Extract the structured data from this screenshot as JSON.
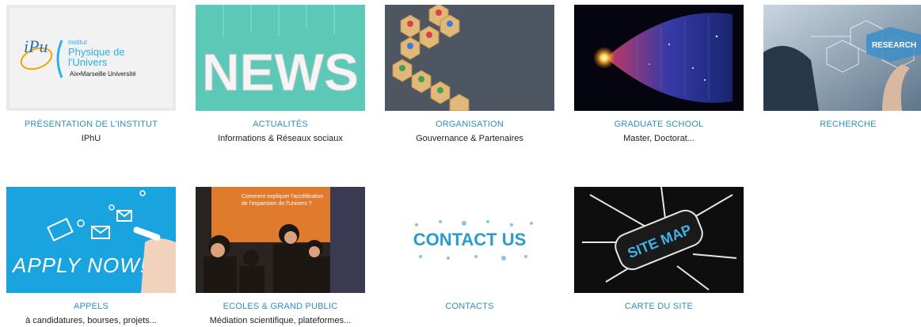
{
  "tiles": [
    {
      "title": "PRÉSENTATION DE L'INSTITUT",
      "subtitle": "IPhU",
      "logo": {
        "letters": "iPu",
        "line1": "Institut",
        "line2": "Physique de",
        "line3": "l'Univers",
        "line4": "Aix•Marseille Université"
      }
    },
    {
      "title": "ACTUALITÉS",
      "subtitle": "Informations & Réseaux sociaux",
      "image_text": "NEWS"
    },
    {
      "title": "ORGANISATION",
      "subtitle": "Gouvernance & Partenaires"
    },
    {
      "title": "GRADUATE SCHOOL",
      "subtitle": "Master, Doctorat..."
    },
    {
      "title": "RECHERCHE",
      "subtitle": "",
      "image_text": "RESEARCH"
    },
    {
      "title": "APPELS",
      "subtitle": "à candidatures, bourses, projets...",
      "image_text": "APPLY NOW!"
    },
    {
      "title": "ECOLES & GRAND PUBLIC",
      "subtitle": "Médiation scientifique, plateformes...",
      "image_text_line1": "Comment expliquer l'accélération",
      "image_text_line2": "de l'expansion de l'Univers ?"
    },
    {
      "title": "CONTACTS",
      "subtitle": "",
      "image_text": "CONTACT US"
    },
    {
      "title": "CARTE DU SITE",
      "subtitle": "",
      "image_text": "SITE MAP"
    }
  ],
  "colors": {
    "title": "#2d8fbf",
    "subtitle": "#222222",
    "news_bg": "#5cc9b8",
    "apply_bg": "#19a4e0"
  }
}
